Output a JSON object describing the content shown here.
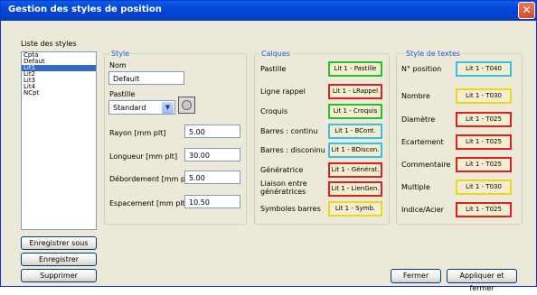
{
  "window": {
    "title": "Gestion des styles de position",
    "close_glyph": "✕"
  },
  "list": {
    "label": "Liste des styles",
    "items": [
      "Cpta",
      "Defaut",
      "Lit1",
      "Lit2",
      "Lit3",
      "Lit4",
      "NCpt"
    ],
    "selected": "Lit1"
  },
  "style": {
    "header": "Style",
    "nom_label": "Nom",
    "nom_value": "Default",
    "pastille_label": "Pastille",
    "pastille_value": "Standard",
    "rayon_label": "Rayon [mm plt]",
    "rayon_value": "5.00",
    "longueur_label": "Longueur [mm plt]",
    "longueur_value": "30.00",
    "debordement_label": "Débordement [mm plt]",
    "debordement_value": "5.00",
    "espacement_label": "Espacement [mm plt]",
    "espacement_value": "10.50"
  },
  "calques": {
    "header": "Calques",
    "rows": [
      {
        "label": "Pastille",
        "value": "Lit 1 - Pastille",
        "color": "#22c22e"
      },
      {
        "label": "Ligne rappel",
        "value": "Lit 1 - LRappel",
        "color": "#e02020"
      },
      {
        "label": "Croquis",
        "value": "Lit 1 - Croquis",
        "color": "#22c22e"
      },
      {
        "label": "Barres : continu",
        "value": "Lit 1 - BCont.",
        "color": "#36c0e8"
      },
      {
        "label": "Barres : disconinu",
        "value": "Lit 1 - BDiscon.",
        "color": "#36c0e8"
      },
      {
        "label": "Génératrice",
        "value": "Lit 1 - Générat.",
        "color": "#e02020"
      },
      {
        "label": "Liaison entre",
        "label2": "génératrices",
        "value": "Lit 1 - LienGen.",
        "color": "#e02020"
      },
      {
        "label": "Symboles barres",
        "value": "Lit 1 - Symb.",
        "color": "#e8d820"
      }
    ]
  },
  "textes": {
    "header": "Style de textes",
    "rows": [
      {
        "label": "N° position",
        "value": "Lit 1 - T040",
        "color": "#36c0e8"
      },
      {
        "label": "Nombre",
        "value": "Lit 1 - T030",
        "color": "#e8d820"
      },
      {
        "label": "Diamètre",
        "value": "Lit 1 - T025",
        "color": "#e02020"
      },
      {
        "label": "Ecartement",
        "value": "Lit 1 - T025",
        "color": "#e02020"
      },
      {
        "label": "Commentaire",
        "value": "Lit 1 - T025",
        "color": "#e02020"
      },
      {
        "label": "Multiple",
        "value": "Lit 1 - T030",
        "color": "#e8d820"
      },
      {
        "label": "Indice/Acier",
        "value": "Lit 1 - T025",
        "color": "#e02020"
      }
    ]
  },
  "buttons": {
    "save_as": "Enregistrer sous",
    "save": "Enregistrer",
    "delete": "Supprimer",
    "close": "Fermer",
    "apply_close": "Appliquer et fermer"
  }
}
